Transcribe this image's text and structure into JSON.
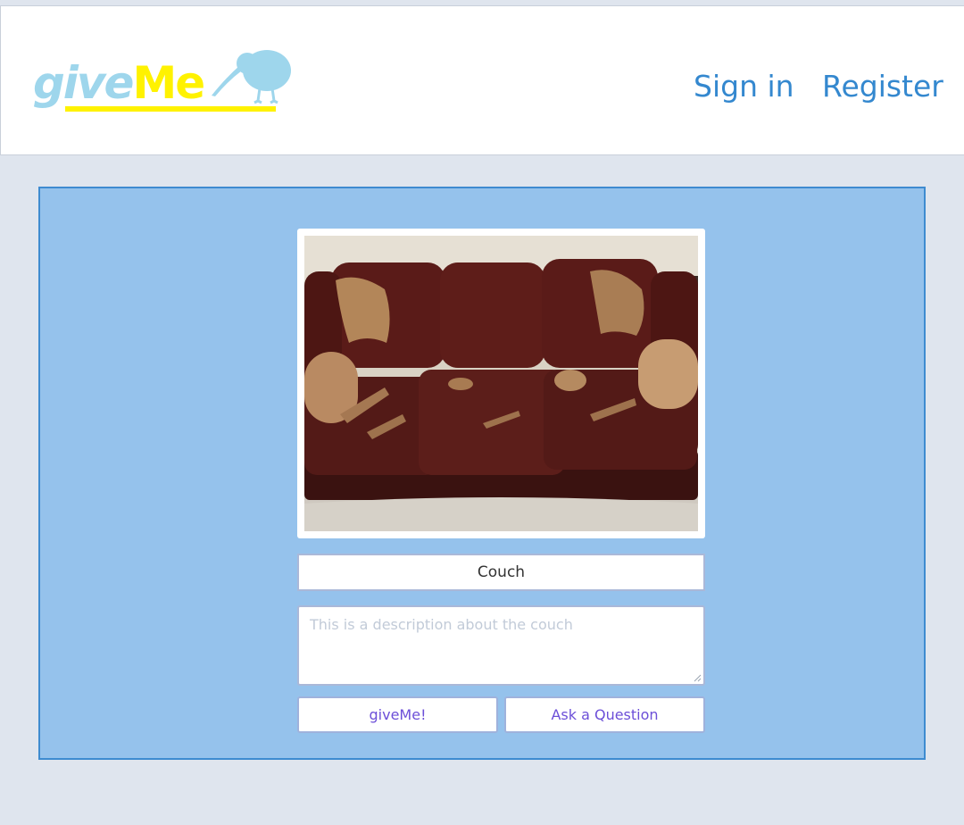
{
  "header": {
    "logo": {
      "give": "give",
      "me": "Me",
      "icon": "kiwi-bird-icon"
    },
    "nav": {
      "sign_in": "Sign in",
      "register": "Register"
    }
  },
  "item": {
    "image": "leather-couch-photo",
    "title": "Couch",
    "description_placeholder": "This is a description about the couch"
  },
  "actions": {
    "give_me": "giveMe!",
    "ask_question": "Ask a Question"
  },
  "colors": {
    "page_bg": "#dfe5ee",
    "panel_bg": "#95c2ec",
    "panel_border": "#3e8bd0",
    "nav_link": "#3488cf",
    "logo_blue": "#9ed6ec",
    "logo_yellow": "#fff200",
    "button_text": "#6c4fd8"
  }
}
